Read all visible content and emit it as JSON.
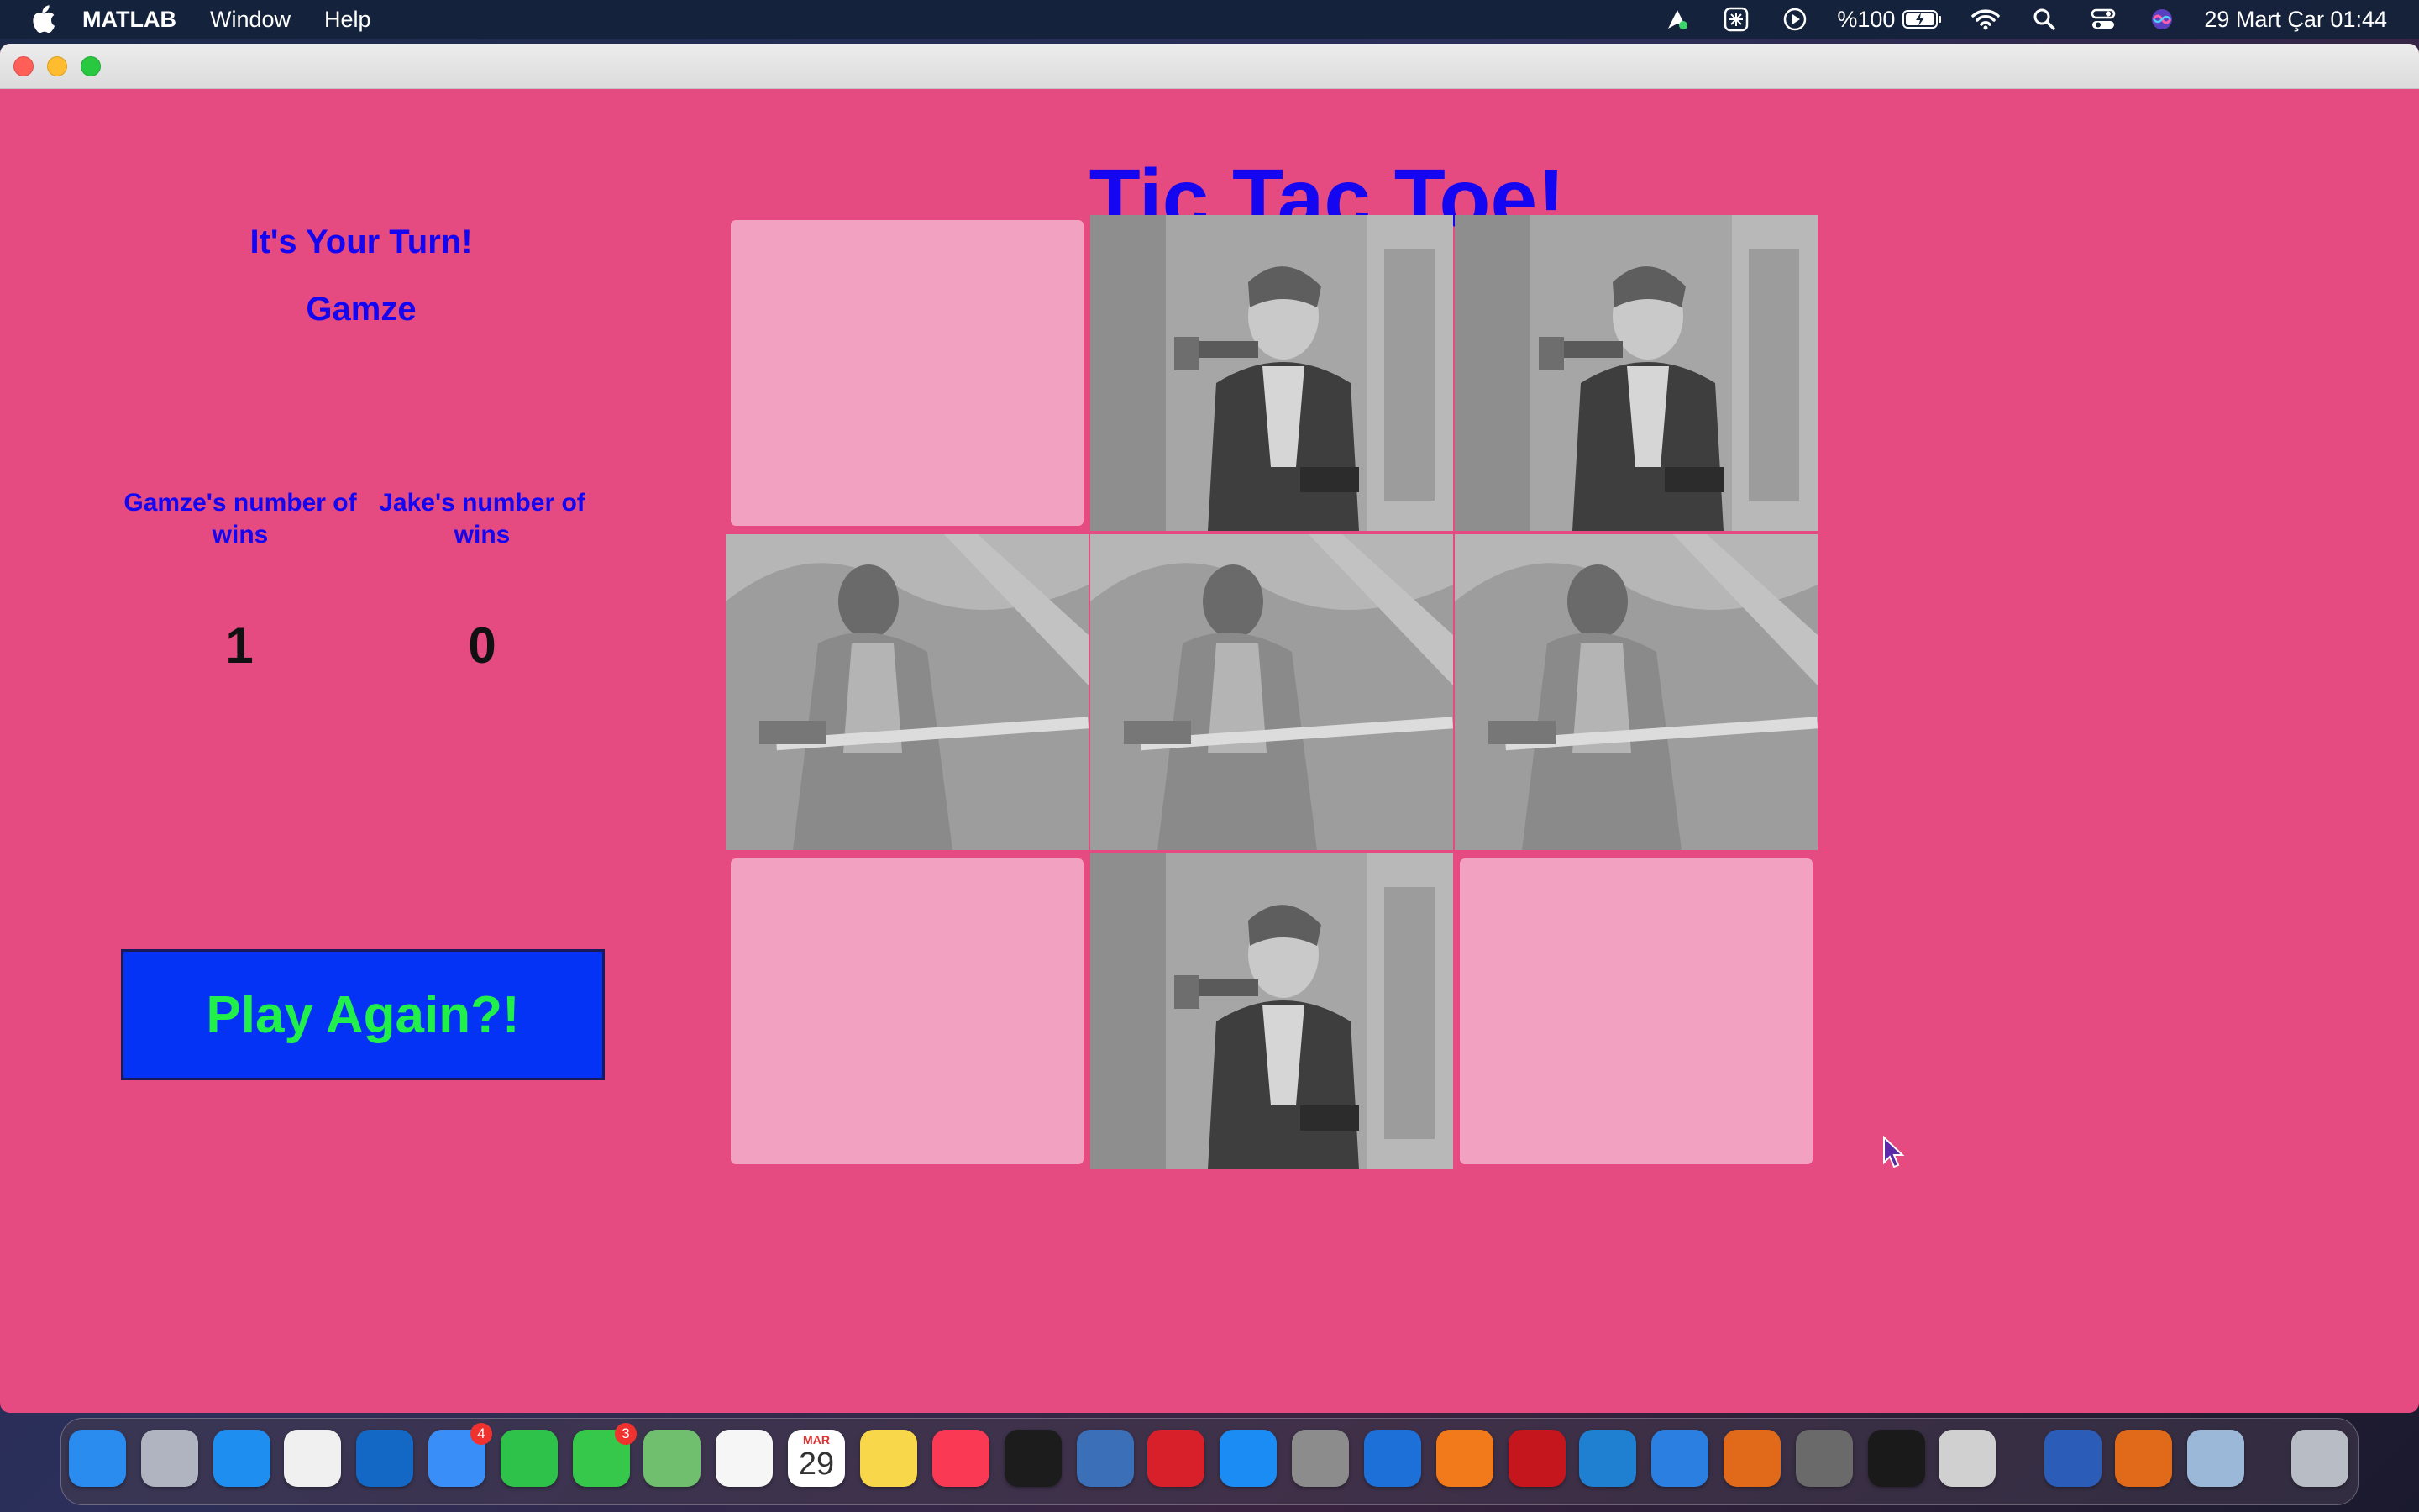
{
  "menubar": {
    "app_name": "MATLAB",
    "menus": [
      "Window",
      "Help"
    ],
    "battery": "%100",
    "datetime": "29 Mart Çar  01:44"
  },
  "game": {
    "title": "Tic Tac Toe!",
    "turn_label": "It's Your Turn!",
    "current_player": "Gamze",
    "scores": [
      {
        "label": "Gamze's number of wins",
        "value": "1"
      },
      {
        "label": "Jake's number of wins",
        "value": "0"
      }
    ],
    "play_again_label": "Play Again?!",
    "board": [
      [
        "empty",
        "han-solo",
        "han-solo"
      ],
      [
        "mace-windu",
        "mace-windu",
        "mace-windu"
      ],
      [
        "empty",
        "han-solo",
        "empty"
      ]
    ]
  },
  "dock": {
    "badges": {
      "mail": "4",
      "messages": "3"
    },
    "calendar_month": "MAR",
    "calendar_day": "29"
  },
  "colors": {
    "window_bg": "#e54b80",
    "title_text": "#1406f0",
    "empty_tile": "#f2a1c0",
    "button_bg": "#0433f5",
    "button_text": "#22f04a"
  }
}
